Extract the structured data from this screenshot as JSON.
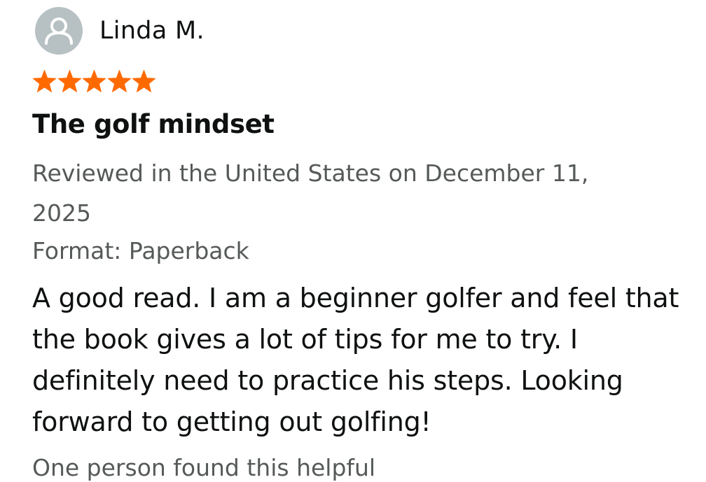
{
  "reviewer": {
    "name": "Linda M.",
    "avatar_icon": "person-silhouette-icon"
  },
  "rating": {
    "value": 5,
    "max": 5,
    "star_color": "#ff6a00"
  },
  "review": {
    "title": "The golf mindset",
    "reviewed_line": "Reviewed in the United States on December 11, 2025",
    "format": "Format: Paperback",
    "body": "A good read. I am a beginner golfer and feel that the book gives a lot of tips for me to try. I definitely need to practice his steps. Looking forward to getting out golfing!",
    "helpful_text": "One person found this helpful"
  }
}
